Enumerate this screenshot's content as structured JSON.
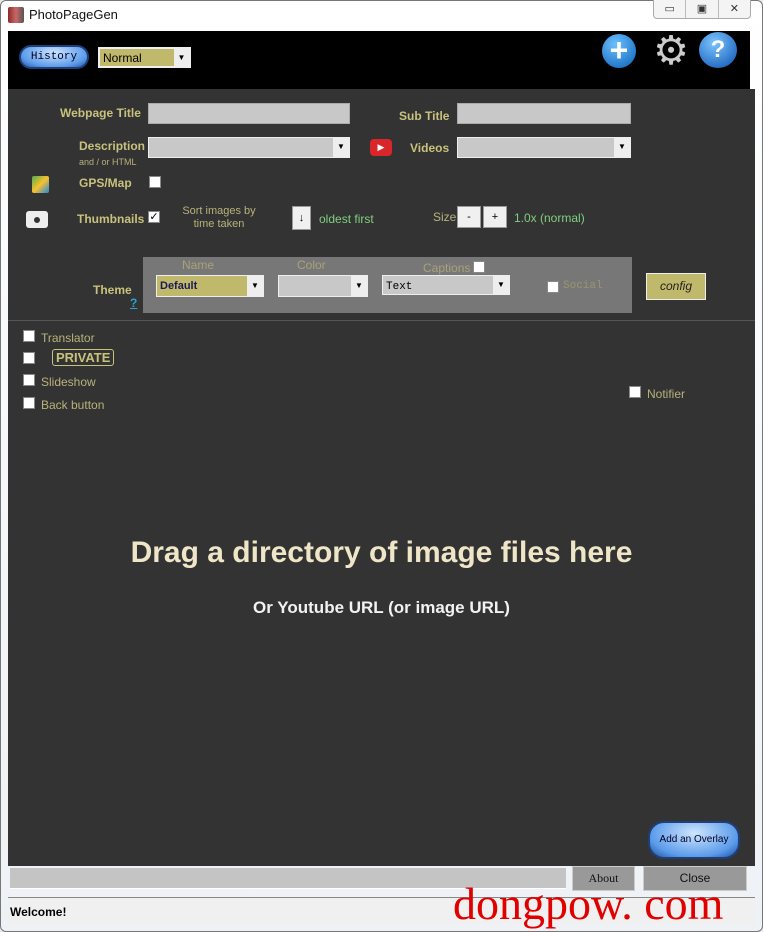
{
  "window": {
    "title": "PhotoPageGen",
    "minimize": "▭",
    "maximize": "▣",
    "close": "✕"
  },
  "header": {
    "history_label": "History",
    "mode_value": "Normal",
    "add_icon": "plus-circle-icon",
    "settings_icon": "gear-icon",
    "help_icon": "help-icon"
  },
  "form": {
    "webpage_title_label": "Webpage Title",
    "webpage_title_value": "",
    "subtitle_label": "Sub Title",
    "subtitle_value": "",
    "description_label": "Description",
    "description_sub": "and / or HTML",
    "description_value": "",
    "videos_label": "Videos",
    "videos_value": "",
    "gps_label": "GPS/Map",
    "gps_checked": false,
    "thumbnails_label": "Thumbnails",
    "thumbnails_checked": true,
    "sort_label": "Sort images by time taken",
    "sort_order_icon": "↓",
    "sort_order_label": "oldest first",
    "size_label": "Size",
    "size_minus": "-",
    "size_plus": "+",
    "size_value": "1.0x (normal)"
  },
  "theme": {
    "label": "Theme",
    "help": "?",
    "name_label": "Name",
    "name_value": "Default",
    "color_label": "Color",
    "color_value": "",
    "captions_label": "Captions",
    "captions_checked": false,
    "captions_value": "Text",
    "social_label": "Social",
    "social_checked": false,
    "config_label": "config"
  },
  "options": [
    {
      "label": "Translator",
      "checked": false
    },
    {
      "label": "PRIVATE",
      "checked": false
    },
    {
      "label": "Slideshow",
      "checked": false
    },
    {
      "label": "Back button",
      "checked": false
    }
  ],
  "notifier": {
    "label": "Notifier",
    "checked": false
  },
  "dropzone": {
    "main": "Drag a directory of image files here",
    "sub": "Or Youtube URL (or image URL)"
  },
  "footer": {
    "overlay_label": "Add an Overlay",
    "url_value": "",
    "about_label": "About",
    "close_label": "Close",
    "status": "Welcome!"
  },
  "watermark": "dongpow. com"
}
